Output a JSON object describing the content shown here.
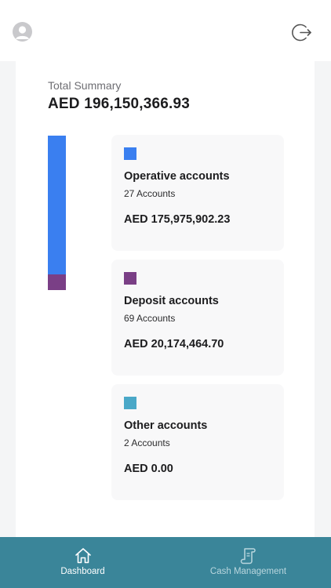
{
  "header": {
    "avatar_icon": "user-avatar-icon",
    "logout_icon": "logout-icon"
  },
  "summary": {
    "label": "Total Summary",
    "total": "AED 196,150,366.93"
  },
  "chart_data": {
    "type": "bar",
    "stacked": true,
    "categories": [
      "Operative accounts",
      "Deposit accounts",
      "Other accounts"
    ],
    "values": [
      175975902.23,
      20174464.7,
      0.0
    ],
    "colors": [
      "#3a7ff0",
      "#7a3f86",
      "#4aa8c8"
    ],
    "grid": false,
    "legend": "right"
  },
  "accounts": [
    {
      "name": "Operative accounts",
      "count": "27 Accounts",
      "amount": "AED 175,975,902.23",
      "color": "#3a7ff0"
    },
    {
      "name": "Deposit accounts",
      "count": "69 Accounts",
      "amount": "AED 20,174,464.70",
      "color": "#7a3f86"
    },
    {
      "name": "Other accounts",
      "count": "2 Accounts",
      "amount": "AED 0.00",
      "color": "#4aa8c8"
    }
  ],
  "nav": {
    "items": [
      {
        "label": "Dashboard",
        "icon": "home-icon",
        "active": true
      },
      {
        "label": "Cash Management",
        "icon": "scroll-icon",
        "active": false
      }
    ]
  }
}
